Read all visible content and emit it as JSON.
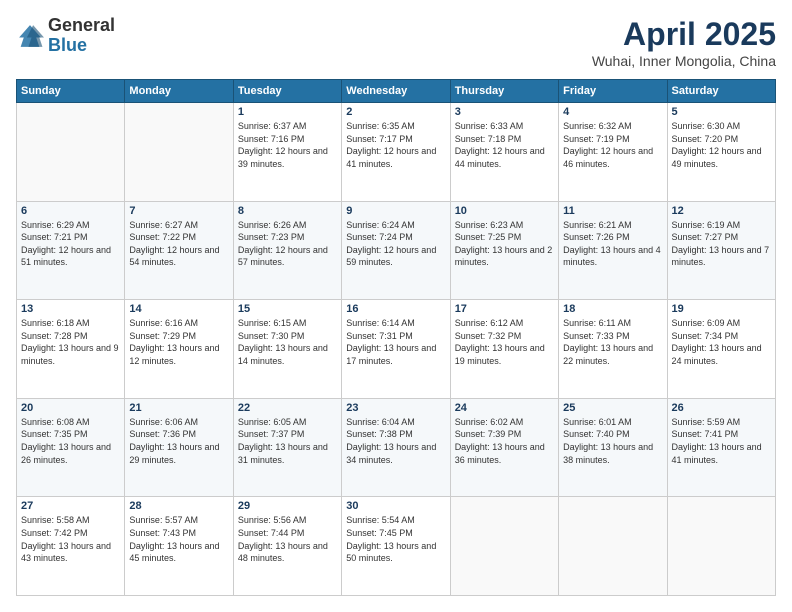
{
  "header": {
    "logo_line1": "General",
    "logo_line2": "Blue",
    "title": "April 2025",
    "subtitle": "Wuhai, Inner Mongolia, China"
  },
  "weekdays": [
    "Sunday",
    "Monday",
    "Tuesday",
    "Wednesday",
    "Thursday",
    "Friday",
    "Saturday"
  ],
  "weeks": [
    [
      {
        "day": "",
        "sunrise": "",
        "sunset": "",
        "daylight": ""
      },
      {
        "day": "",
        "sunrise": "",
        "sunset": "",
        "daylight": ""
      },
      {
        "day": "1",
        "sunrise": "Sunrise: 6:37 AM",
        "sunset": "Sunset: 7:16 PM",
        "daylight": "Daylight: 12 hours and 39 minutes."
      },
      {
        "day": "2",
        "sunrise": "Sunrise: 6:35 AM",
        "sunset": "Sunset: 7:17 PM",
        "daylight": "Daylight: 12 hours and 41 minutes."
      },
      {
        "day": "3",
        "sunrise": "Sunrise: 6:33 AM",
        "sunset": "Sunset: 7:18 PM",
        "daylight": "Daylight: 12 hours and 44 minutes."
      },
      {
        "day": "4",
        "sunrise": "Sunrise: 6:32 AM",
        "sunset": "Sunset: 7:19 PM",
        "daylight": "Daylight: 12 hours and 46 minutes."
      },
      {
        "day": "5",
        "sunrise": "Sunrise: 6:30 AM",
        "sunset": "Sunset: 7:20 PM",
        "daylight": "Daylight: 12 hours and 49 minutes."
      }
    ],
    [
      {
        "day": "6",
        "sunrise": "Sunrise: 6:29 AM",
        "sunset": "Sunset: 7:21 PM",
        "daylight": "Daylight: 12 hours and 51 minutes."
      },
      {
        "day": "7",
        "sunrise": "Sunrise: 6:27 AM",
        "sunset": "Sunset: 7:22 PM",
        "daylight": "Daylight: 12 hours and 54 minutes."
      },
      {
        "day": "8",
        "sunrise": "Sunrise: 6:26 AM",
        "sunset": "Sunset: 7:23 PM",
        "daylight": "Daylight: 12 hours and 57 minutes."
      },
      {
        "day": "9",
        "sunrise": "Sunrise: 6:24 AM",
        "sunset": "Sunset: 7:24 PM",
        "daylight": "Daylight: 12 hours and 59 minutes."
      },
      {
        "day": "10",
        "sunrise": "Sunrise: 6:23 AM",
        "sunset": "Sunset: 7:25 PM",
        "daylight": "Daylight: 13 hours and 2 minutes."
      },
      {
        "day": "11",
        "sunrise": "Sunrise: 6:21 AM",
        "sunset": "Sunset: 7:26 PM",
        "daylight": "Daylight: 13 hours and 4 minutes."
      },
      {
        "day": "12",
        "sunrise": "Sunrise: 6:19 AM",
        "sunset": "Sunset: 7:27 PM",
        "daylight": "Daylight: 13 hours and 7 minutes."
      }
    ],
    [
      {
        "day": "13",
        "sunrise": "Sunrise: 6:18 AM",
        "sunset": "Sunset: 7:28 PM",
        "daylight": "Daylight: 13 hours and 9 minutes."
      },
      {
        "day": "14",
        "sunrise": "Sunrise: 6:16 AM",
        "sunset": "Sunset: 7:29 PM",
        "daylight": "Daylight: 13 hours and 12 minutes."
      },
      {
        "day": "15",
        "sunrise": "Sunrise: 6:15 AM",
        "sunset": "Sunset: 7:30 PM",
        "daylight": "Daylight: 13 hours and 14 minutes."
      },
      {
        "day": "16",
        "sunrise": "Sunrise: 6:14 AM",
        "sunset": "Sunset: 7:31 PM",
        "daylight": "Daylight: 13 hours and 17 minutes."
      },
      {
        "day": "17",
        "sunrise": "Sunrise: 6:12 AM",
        "sunset": "Sunset: 7:32 PM",
        "daylight": "Daylight: 13 hours and 19 minutes."
      },
      {
        "day": "18",
        "sunrise": "Sunrise: 6:11 AM",
        "sunset": "Sunset: 7:33 PM",
        "daylight": "Daylight: 13 hours and 22 minutes."
      },
      {
        "day": "19",
        "sunrise": "Sunrise: 6:09 AM",
        "sunset": "Sunset: 7:34 PM",
        "daylight": "Daylight: 13 hours and 24 minutes."
      }
    ],
    [
      {
        "day": "20",
        "sunrise": "Sunrise: 6:08 AM",
        "sunset": "Sunset: 7:35 PM",
        "daylight": "Daylight: 13 hours and 26 minutes."
      },
      {
        "day": "21",
        "sunrise": "Sunrise: 6:06 AM",
        "sunset": "Sunset: 7:36 PM",
        "daylight": "Daylight: 13 hours and 29 minutes."
      },
      {
        "day": "22",
        "sunrise": "Sunrise: 6:05 AM",
        "sunset": "Sunset: 7:37 PM",
        "daylight": "Daylight: 13 hours and 31 minutes."
      },
      {
        "day": "23",
        "sunrise": "Sunrise: 6:04 AM",
        "sunset": "Sunset: 7:38 PM",
        "daylight": "Daylight: 13 hours and 34 minutes."
      },
      {
        "day": "24",
        "sunrise": "Sunrise: 6:02 AM",
        "sunset": "Sunset: 7:39 PM",
        "daylight": "Daylight: 13 hours and 36 minutes."
      },
      {
        "day": "25",
        "sunrise": "Sunrise: 6:01 AM",
        "sunset": "Sunset: 7:40 PM",
        "daylight": "Daylight: 13 hours and 38 minutes."
      },
      {
        "day": "26",
        "sunrise": "Sunrise: 5:59 AM",
        "sunset": "Sunset: 7:41 PM",
        "daylight": "Daylight: 13 hours and 41 minutes."
      }
    ],
    [
      {
        "day": "27",
        "sunrise": "Sunrise: 5:58 AM",
        "sunset": "Sunset: 7:42 PM",
        "daylight": "Daylight: 13 hours and 43 minutes."
      },
      {
        "day": "28",
        "sunrise": "Sunrise: 5:57 AM",
        "sunset": "Sunset: 7:43 PM",
        "daylight": "Daylight: 13 hours and 45 minutes."
      },
      {
        "day": "29",
        "sunrise": "Sunrise: 5:56 AM",
        "sunset": "Sunset: 7:44 PM",
        "daylight": "Daylight: 13 hours and 48 minutes."
      },
      {
        "day": "30",
        "sunrise": "Sunrise: 5:54 AM",
        "sunset": "Sunset: 7:45 PM",
        "daylight": "Daylight: 13 hours and 50 minutes."
      },
      {
        "day": "",
        "sunrise": "",
        "sunset": "",
        "daylight": ""
      },
      {
        "day": "",
        "sunrise": "",
        "sunset": "",
        "daylight": ""
      },
      {
        "day": "",
        "sunrise": "",
        "sunset": "",
        "daylight": ""
      }
    ]
  ]
}
